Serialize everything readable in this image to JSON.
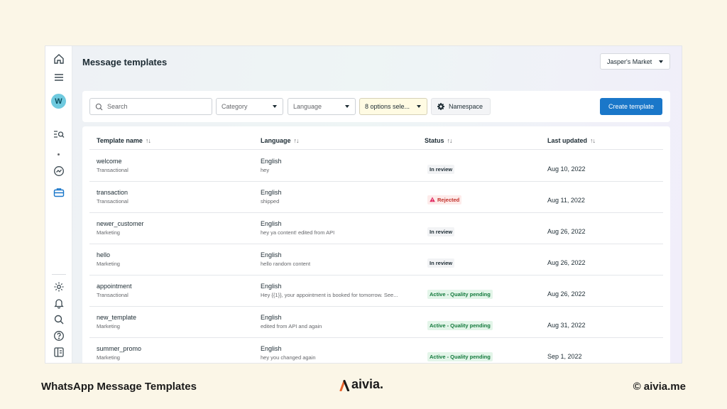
{
  "app": {
    "page_title": "Message templates",
    "account": "Jasper's Market",
    "avatar_letter": "W"
  },
  "rail": {
    "icons": [
      "home-icon",
      "menu-icon",
      "avatar",
      "list-search-icon",
      "dot",
      "insights-icon",
      "briefcase-icon",
      "settings-icon",
      "bell-icon",
      "search-icon",
      "help-icon",
      "panel-icon"
    ],
    "active_icon": "briefcase-icon",
    "active_color": "#1a77c9"
  },
  "toolbar": {
    "search_placeholder": "Search",
    "category": "Category",
    "language": "Language",
    "status_filter": "8 options sele...",
    "namespace": "Namespace",
    "create_label": "Create template"
  },
  "table": {
    "columns": [
      "Template name",
      "Language",
      "Status",
      "Last updated"
    ],
    "sort_glyph": "↑↓",
    "rows": [
      {
        "name": "welcome",
        "category": "Transactional",
        "language": "English",
        "content": "hey",
        "status": "In review",
        "status_type": "review",
        "updated": "Aug 10, 2022"
      },
      {
        "name": "transaction",
        "category": "Transactional",
        "language": "English",
        "content": "shipped",
        "status": "Rejected",
        "status_type": "rejected",
        "updated": "Aug 11, 2022"
      },
      {
        "name": "newer_customer",
        "category": "Marketing",
        "language": "English",
        "content": "hey ya content! edited from API",
        "status": "In review",
        "status_type": "review",
        "updated": "Aug 26, 2022"
      },
      {
        "name": "hello",
        "category": "Marketing",
        "language": "English",
        "content": "hello random content",
        "status": "In review",
        "status_type": "review",
        "updated": "Aug 26, 2022"
      },
      {
        "name": "appointment",
        "category": "Transactional",
        "language": "English",
        "content": "Hey {{1}}, your appointment is booked for tomorrow. See...",
        "status": "Active - Quality pending",
        "status_type": "active",
        "updated": "Aug 26, 2022"
      },
      {
        "name": "new_template",
        "category": "Marketing",
        "language": "English",
        "content": "edited from API and again",
        "status": "Active - Quality pending",
        "status_type": "active",
        "updated": "Aug 31, 2022"
      },
      {
        "name": "summer_promo",
        "category": "Marketing",
        "language": "English",
        "content": "hey you changed again",
        "status": "Active - Quality pending",
        "status_type": "active",
        "updated": "Sep 1, 2022"
      }
    ]
  },
  "captions": {
    "left": "WhatsApp Message Templates",
    "brand": "aivia.",
    "right": "© aivia.me",
    "brand_color": "#e8632b"
  }
}
